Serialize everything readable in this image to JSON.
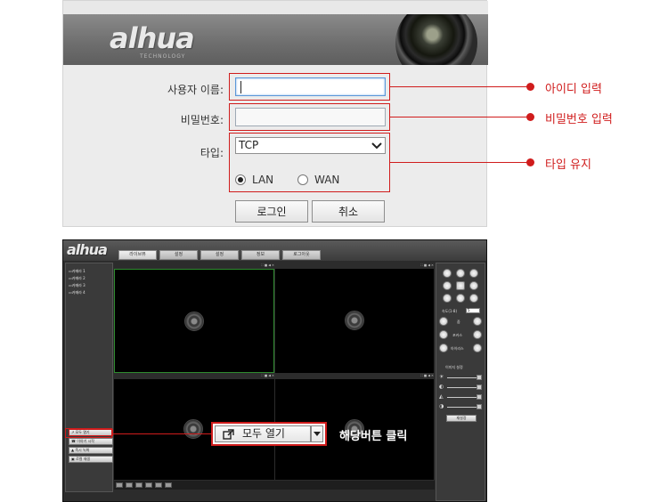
{
  "login": {
    "brand": "alhua",
    "brand_sub": "TECHNOLOGY",
    "username_label": "사용자 이름:",
    "username_value": "",
    "password_label": "비밀번호:",
    "password_value": "",
    "type_label": "타입:",
    "type_selected": "TCP",
    "radio_lan": "LAN",
    "radio_wan": "WAN",
    "radio_selected": "LAN",
    "login_button": "로그인",
    "cancel_button": "취소"
  },
  "callouts": {
    "username": "아이디 입력",
    "password": "비밀번호 입력",
    "type": "타입 유지",
    "click": "해당버튼 클릭"
  },
  "live": {
    "brand": "alhua",
    "tabs": [
      "라이브뷰",
      "설정",
      "설정",
      "정보",
      "로그아웃"
    ],
    "cameras": [
      "카메라 1",
      "카메라 2",
      "카메라 3",
      "카메라 4"
    ],
    "side_buttons": [
      "모두 열기",
      "이야기 시작",
      "즉시 녹화",
      "로컬 재생"
    ],
    "cell_toolbar": "⛶ ■ ◀ ✕",
    "ptz": {
      "speed_label": "속도(1-8)",
      "speed_value": "5",
      "zoom_label": "줌",
      "focus_label": "포커스",
      "iris_label": "아이리스",
      "image_settings": "이미지 설정",
      "reset_button": "재설정"
    },
    "open_all_button": "모두 열기"
  },
  "colors": {
    "callout_red": "#d01c1c",
    "input_focus": "#5b97d8"
  }
}
